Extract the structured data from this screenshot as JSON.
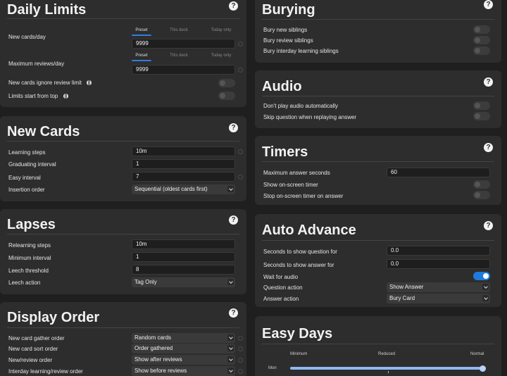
{
  "daily_limits": {
    "title": "Daily Limits",
    "tabs": [
      "Preset",
      "This deck",
      "Today only"
    ],
    "new_cards_label": "New cards/day",
    "new_cards_value": "9999",
    "max_reviews_label": "Maximum reviews/day",
    "max_reviews_value": "9999",
    "ignore_review_limit_label": "New cards ignore review limit",
    "limits_from_top_label": "Limits start from top"
  },
  "new_cards": {
    "title": "New Cards",
    "learning_steps_label": "Learning steps",
    "learning_steps_value": "10m",
    "graduating_label": "Graduating interval",
    "graduating_value": "1",
    "easy_label": "Easy interval",
    "easy_value": "7",
    "insertion_label": "Insertion order",
    "insertion_value": "Sequential (oldest cards first)"
  },
  "lapses": {
    "title": "Lapses",
    "relearning_label": "Relearning steps",
    "relearning_value": "10m",
    "min_interval_label": "Minimum interval",
    "min_interval_value": "1",
    "leech_threshold_label": "Leech threshold",
    "leech_threshold_value": "8",
    "leech_action_label": "Leech action",
    "leech_action_value": "Tag Only"
  },
  "display_order": {
    "title": "Display Order",
    "gather_label": "New card gather order",
    "gather_value": "Random cards",
    "sort_label": "New card sort order",
    "sort_value": "Order gathered",
    "new_review_label": "New/review order",
    "new_review_value": "Show after reviews",
    "interday_label": "Interday learning/review order",
    "interday_value": "Show before reviews"
  },
  "burying": {
    "title": "Burying",
    "new_siblings_label": "Bury new siblings",
    "review_siblings_label": "Bury review siblings",
    "interday_siblings_label": "Bury interday learning siblings"
  },
  "audio": {
    "title": "Audio",
    "auto_play_label": "Don't play audio automatically",
    "skip_question_label": "Skip question when replaying answer"
  },
  "timers": {
    "title": "Timers",
    "max_answer_label": "Maximum answer seconds",
    "max_answer_value": "60",
    "show_timer_label": "Show on-screen timer",
    "stop_timer_label": "Stop on-screen timer on answer"
  },
  "auto_advance": {
    "title": "Auto Advance",
    "question_secs_label": "Seconds to show question for",
    "question_secs_value": "0.0",
    "answer_secs_label": "Seconds to show answer for",
    "answer_secs_value": "0.0",
    "wait_audio_label": "Wait for audio",
    "question_action_label": "Question action",
    "question_action_value": "Show Answer",
    "answer_action_label": "Answer action",
    "answer_action_value": "Bury Card"
  },
  "easy_days": {
    "title": "Easy Days",
    "scale": [
      "Minimum",
      "Reduced",
      "Normal"
    ],
    "day_label": "Mon",
    "mon_level": 1.0
  },
  "colors": {
    "background": "#1f1f1f",
    "card": "#2d2d2d",
    "accent": "#2f7de1",
    "toggle_on": "#1e7bdc"
  }
}
